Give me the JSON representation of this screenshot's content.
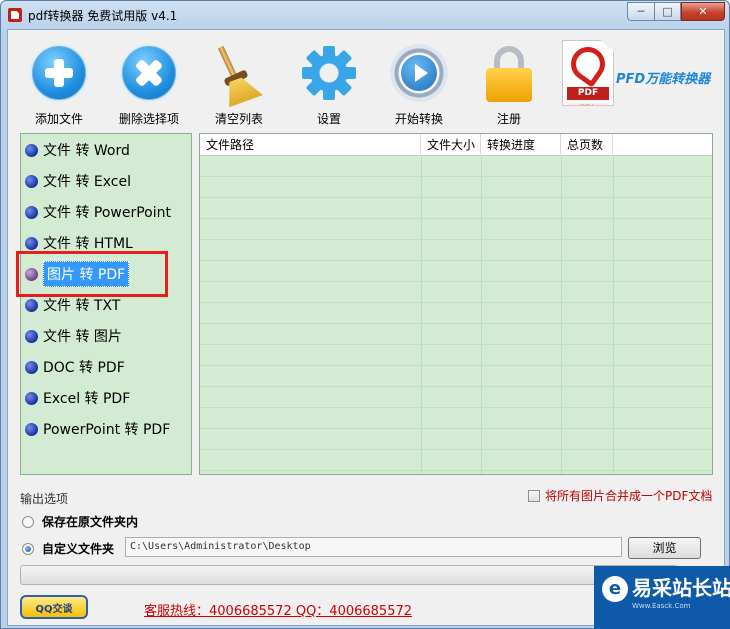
{
  "window": {
    "title": "pdf转换器 免费试用版 v4.1",
    "min": "─",
    "max": "□",
    "close": "✕"
  },
  "toolbar": [
    {
      "id": "add",
      "label": "添加文件",
      "icon": "add-icon"
    },
    {
      "id": "remove",
      "label": "删除选择项",
      "icon": "delete-icon"
    },
    {
      "id": "clear",
      "label": "清空列表",
      "icon": "broom-icon"
    },
    {
      "id": "settings",
      "label": "设置",
      "icon": "gear-icon"
    },
    {
      "id": "start",
      "label": "开始转换",
      "icon": "play-icon"
    },
    {
      "id": "register",
      "label": "注册",
      "icon": "lock-icon"
    }
  ],
  "brand": {
    "logo_text": "PDF",
    "logo_reflection": "bDF",
    "name": "PFD万能转换器"
  },
  "modes": [
    "文件 转 Word",
    "文件 转 Excel",
    "文件 转 PowerPoint",
    "文件 转 HTML",
    "图片 转 PDF",
    "文件 转 TXT",
    "文件 转 图片",
    "DOC 转 PDF",
    "Excel 转 PDF",
    "PowerPoint 转 PDF"
  ],
  "selected_mode_index": 4,
  "table": {
    "columns": [
      "文件路径",
      "文件大小",
      "转换进度",
      "总页数"
    ],
    "rows": []
  },
  "output": {
    "title": "输出选项",
    "merge_label": "将所有图片合并成一个PDF文档",
    "merge_checked": false,
    "option_original": "保存在原文件夹内",
    "option_custom": "自定义文件夹",
    "selected_option": "custom",
    "path_value": "C:\\Users\\Administrator\\Desktop",
    "browse_label": "浏览"
  },
  "progress": {
    "value": 0,
    "label": "0%"
  },
  "footer": {
    "qq_label": "QQ交谈",
    "hotline": "客服热线：4006685572 QQ：4006685572"
  },
  "watermark": {
    "logo": "e",
    "text": "易采站长站",
    "sub": "Www.Easck.Com"
  },
  "colors": {
    "panel_bg": "#d3ebd3",
    "highlight": "#e61e1e",
    "hotline": "#d00000",
    "selection": "#3399ff"
  }
}
